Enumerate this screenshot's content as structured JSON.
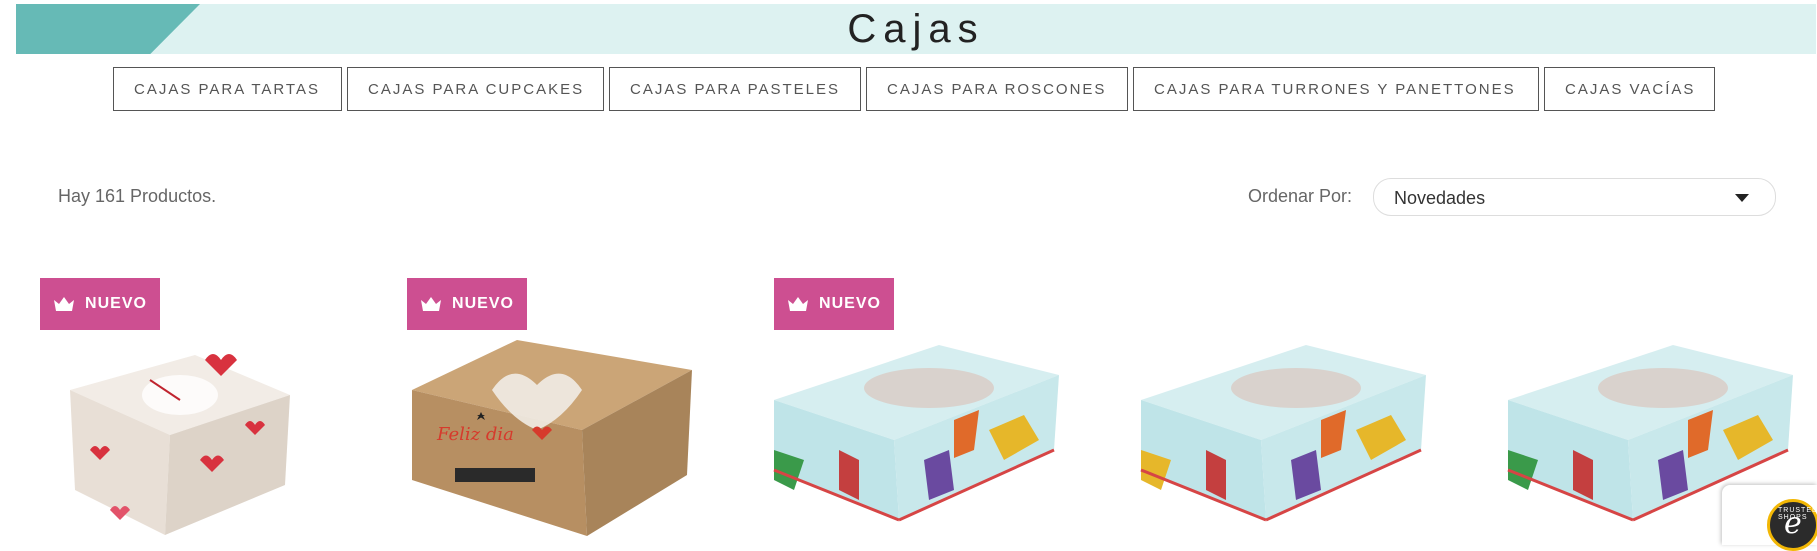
{
  "banner": {
    "title": "Cajas"
  },
  "categories": [
    "CAJAS PARA TARTAS",
    "CAJAS PARA CUPCAKES",
    "CAJAS PARA PASTELES",
    "CAJAS PARA ROSCONES",
    "CAJAS PARA TURRONES Y PANETTONES",
    "CAJAS VACÍAS"
  ],
  "listing": {
    "count_text": "Hay 161 Productos.",
    "sort_label": "Ordenar Por:",
    "sort_value": "Novedades"
  },
  "products": [
    {
      "badge": "NUEVO",
      "image": "valentine-heart-cake-box"
    },
    {
      "badge": "NUEVO",
      "image": "kraft-feliz-dia-box"
    },
    {
      "badge": "NUEVO",
      "image": "reyes-magos-box"
    },
    {
      "badge": "",
      "image": "reyes-magos-box"
    },
    {
      "badge": "",
      "image": "reyes-magos-box"
    }
  ],
  "trust_badge": {
    "text": "TRUSTED SHOPS",
    "letter": "e"
  },
  "colors": {
    "banner_bg": "#ddf2f1",
    "banner_accent": "#66bab6",
    "badge": "#cd4f91"
  }
}
